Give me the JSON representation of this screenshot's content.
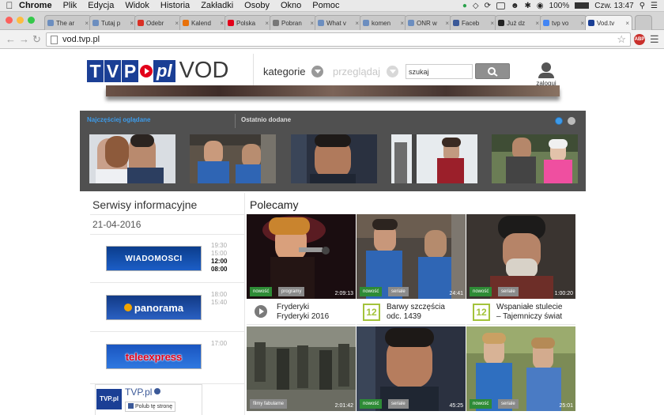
{
  "system_menu": {
    "app": "Chrome",
    "items": [
      "Plik",
      "Edycja",
      "Widok",
      "Historia",
      "Zakładki",
      "Osoby",
      "Okno",
      "Pomoc"
    ],
    "battery": "100%",
    "clock": "Czw. 13:47"
  },
  "tabs": [
    {
      "label": "The ar",
      "color": "#6c8ebf"
    },
    {
      "label": "Tutaj p",
      "color": "#6c8ebf"
    },
    {
      "label": "Odebr",
      "color": "#d93025"
    },
    {
      "label": "Kalend",
      "color": "#e8710a"
    },
    {
      "label": "Polska",
      "color": "#e2001a"
    },
    {
      "label": "Pobran",
      "color": "#777777"
    },
    {
      "label": "What v",
      "color": "#6c8ebf"
    },
    {
      "label": "komen",
      "color": "#6c8ebf"
    },
    {
      "label": "ONR w",
      "color": "#6c8ebf"
    },
    {
      "label": "Faceb",
      "color": "#3b5998"
    },
    {
      "label": "Już dz",
      "color": "#222222"
    },
    {
      "label": "tvp vo",
      "color": "#4285f4"
    },
    {
      "label": "Vod.tv",
      "color": "#1b3f95"
    }
  ],
  "address_bar": {
    "url": "vod.tvp.pl",
    "abp": "ABP"
  },
  "header": {
    "logo_letters": [
      "T",
      "V",
      "P"
    ],
    "logo_pl": "pl",
    "logo_vod": "VOD",
    "nav_categories": "kategorie",
    "nav_browse": "przeglądaj",
    "search_value": "szukaj",
    "login": "zaloguj"
  },
  "carousel": {
    "tab_popular": "Najczęściej oglądane",
    "tab_recent": "Ostatnio dodane"
  },
  "news": {
    "title": "Serwisy informacyjne",
    "date": "21-04-2016",
    "services": [
      {
        "name": "WIADOMOSCI",
        "times": [
          "19:30",
          "15:00",
          "12:00",
          "08:00"
        ],
        "bold_from": 2
      },
      {
        "name": "panorama",
        "times": [
          "18:00",
          "15:40"
        ],
        "bold_from": 9
      },
      {
        "name": "teleexpress",
        "times": [
          "17:00"
        ],
        "bold_from": 9
      }
    ]
  },
  "facebook": {
    "logo": "TVP.pl",
    "name": "TVP.pl",
    "like_label": "Polub tę stronę"
  },
  "recommended": {
    "title": "Polecamy",
    "cards": [
      {
        "badge1": "nowość",
        "badge2": "programy",
        "duration": "2:09:13",
        "icon": "play",
        "line1": "Fryderyki",
        "line2": "Fryderyki 2016"
      },
      {
        "badge1": "nowość",
        "badge2": "seriale",
        "duration": "24:41",
        "icon": "12",
        "line1": "Barwy szczęścia",
        "line2": "odc. 1439"
      },
      {
        "badge1": "nowość",
        "badge2": "seriale",
        "duration": "1:00:20",
        "icon": "12",
        "line1": "Wspaniałe stulecie",
        "line2": "– Tajemniczy świat"
      },
      {
        "badge1": "",
        "badge2": "filmy fabularne",
        "duration": "2:01:42"
      },
      {
        "badge1": "nowość",
        "badge2": "seriale",
        "duration": "45:25"
      },
      {
        "badge1": "nowość",
        "badge2": "seriale",
        "duration": "25:01"
      }
    ]
  },
  "colors": {
    "brand_blue": "#1b3f95",
    "brand_red": "#e2001a",
    "new_badge": "#2e8b36",
    "category_badge": "#8a8a8a",
    "active_carousel_tab": "#3d9be9",
    "badge_12": "#a3c33b"
  }
}
